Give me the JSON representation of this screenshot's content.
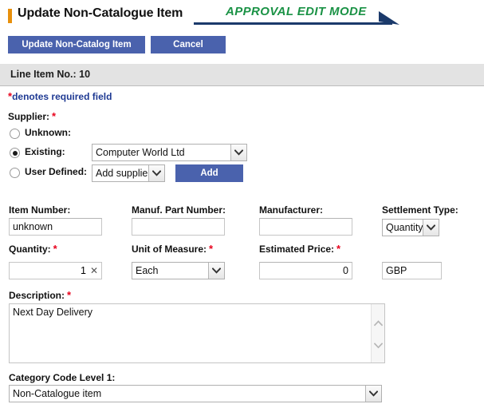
{
  "header": {
    "title": "Update Non-Catalogue Item",
    "mode_banner": "Approval Edit Mode",
    "marker_color": "#e8900c",
    "mode_color": "#1a9245",
    "rule_color": "#1b3a6b"
  },
  "toolbar": {
    "update_label": "Update Non-Catalog Item",
    "cancel_label": "Cancel",
    "button_color": "#4a62ad"
  },
  "line_item": {
    "label": "Line Item No.: 10"
  },
  "required_note": {
    "asterisk": "*",
    "text": "denotes required field",
    "text_color": "#1f3a93",
    "asterisk_color": "#e8001c"
  },
  "supplier": {
    "label": "Supplier:",
    "required": true,
    "options": [
      {
        "label": "Unknown:",
        "selected": false
      },
      {
        "label": "Existing:",
        "selected": true
      },
      {
        "label": "User Defined:",
        "selected": false
      }
    ],
    "existing_select": {
      "value": "Computer World Ltd"
    },
    "user_defined_select": {
      "value": "Add supplier"
    },
    "add_button_label": "Add"
  },
  "fields": {
    "item_number": {
      "label": "Item Number:",
      "value": "unknown",
      "required": false
    },
    "manuf_part_number": {
      "label": "Manuf. Part Number:",
      "value": "",
      "required": false
    },
    "manufacturer": {
      "label": "Manufacturer:",
      "value": "",
      "required": false
    },
    "settlement_type": {
      "label": "Settlement Type:",
      "value": "Quantity",
      "required": false
    },
    "quantity": {
      "label": "Quantity:",
      "value": "1",
      "clear_glyph": "✕",
      "required": true
    },
    "unit_of_measure": {
      "label": "Unit of Measure:",
      "value": "Each",
      "required": true
    },
    "estimated_price": {
      "label": "Estimated Price:",
      "value": "0",
      "required": true
    },
    "currency": {
      "label": "",
      "value": "GBP",
      "required": false
    },
    "description": {
      "label": "Description:",
      "value": "Next Day Delivery",
      "required": true
    },
    "category_code_level_1": {
      "label": "Category Code Level 1:",
      "value": "Non-Catalogue item",
      "required": false
    }
  }
}
